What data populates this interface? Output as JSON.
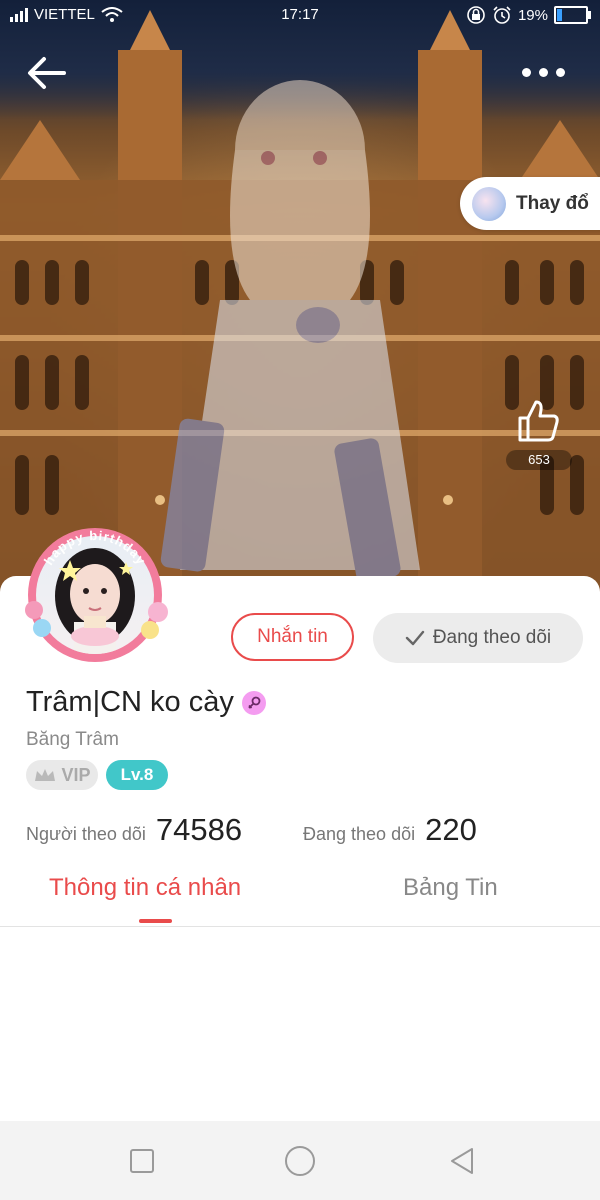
{
  "status_bar": {
    "carrier": "VIETTEL",
    "time": "17:17",
    "battery": "19%",
    "battery_level": 0.19
  },
  "hero": {
    "change_button_label": "Thay đổ",
    "like_count": "653"
  },
  "profile": {
    "display_name": "Trâm|CN ko cày",
    "username": "Băng Trâm",
    "vip_label": "VIP",
    "level_label": "Lv.8",
    "avatar_frame_text": "happy birthday"
  },
  "actions": {
    "message_label": "Nhắn tin",
    "following_label": "Đang theo dõi"
  },
  "stats": {
    "followers_label": "Người theo dõi",
    "followers_value": "74586",
    "following_label": "Đang theo dõi",
    "following_value": "220"
  },
  "tabs": [
    {
      "label": "Thông tin cá nhân",
      "active": true
    },
    {
      "label": "Bảng Tin",
      "active": false
    }
  ],
  "colors": {
    "accent": "#e94b4b",
    "level_badge": "#41c7c9",
    "gender_badge": "#f49cf0"
  }
}
